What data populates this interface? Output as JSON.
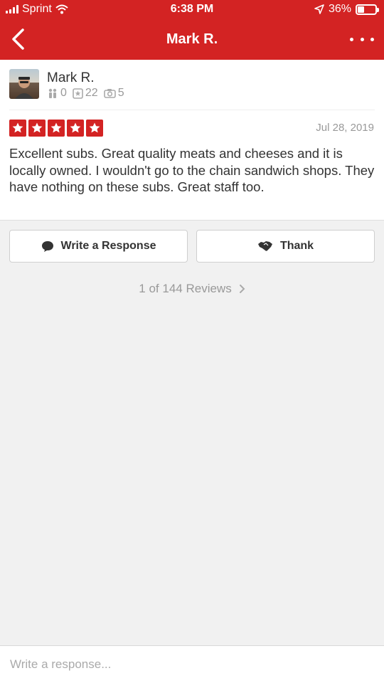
{
  "status_bar": {
    "carrier": "Sprint",
    "time": "6:38 PM",
    "battery": "36%",
    "battery_level": 0.36
  },
  "nav": {
    "title": "Mark R.",
    "back_icon": "chevron-left-icon",
    "more_icon": "more-horizontal-icon"
  },
  "review": {
    "user_name": "Mark R.",
    "friends": "0",
    "reviews": "22",
    "photos": "5",
    "rating": 5,
    "date": "Jul 28, 2019",
    "text": "Excellent subs.  Great quality meats and cheeses and it is locally owned.  I wouldn't go to the chain sandwich shops.  They have nothing on these subs.  Great staff too."
  },
  "actions": {
    "respond_label": "Write a Response",
    "thank_label": "Thank"
  },
  "pager": {
    "label": "1 of 144 Reviews"
  },
  "compose": {
    "placeholder": "Write a response..."
  },
  "colors": {
    "brand": "#d32323"
  }
}
